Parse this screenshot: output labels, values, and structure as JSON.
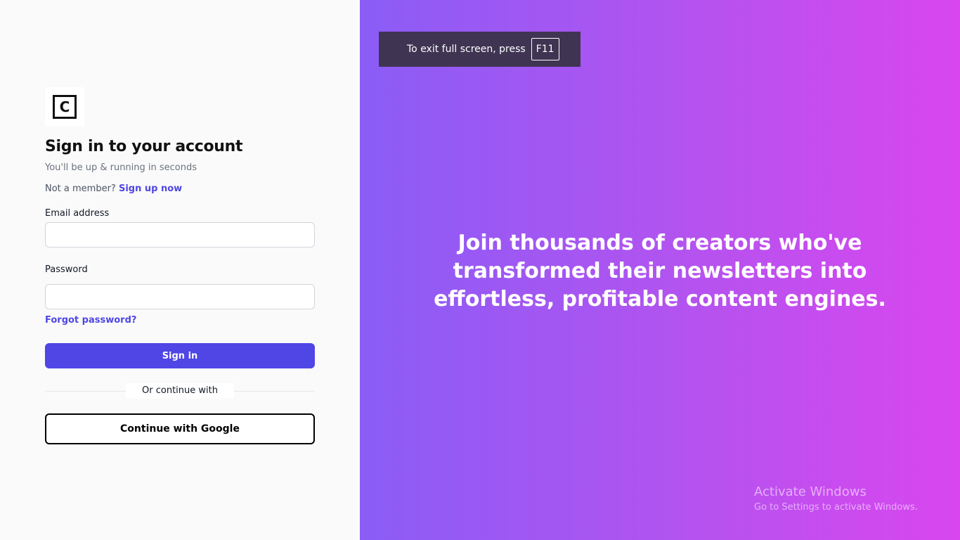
{
  "brand": {
    "logo_letter": "C"
  },
  "signin": {
    "title": "Sign in to your account",
    "subtitle": "You'll be up & running in seconds",
    "member_prompt": "Not a member?",
    "signup_link": "Sign up now",
    "email_label": "Email address",
    "email_value": "",
    "password_label": "Password",
    "password_value": "",
    "forgot_link": "Forgot password?",
    "signin_button": "Sign in",
    "divider_text": "Or continue with",
    "google_button": "Continue with Google"
  },
  "overlay": {
    "fullscreen_text": "To exit full screen, press",
    "fullscreen_key": "F11"
  },
  "hero": {
    "headline": "Join thousands of creators who've transformed their newsletters into effortless, profitable content engines."
  },
  "watermark": {
    "title": "Activate Windows",
    "subtitle": "Go to Settings to activate Windows."
  },
  "colors": {
    "accent": "#4f46e5",
    "gradient_start": "#8b5cf6",
    "gradient_end": "#d946ef"
  }
}
